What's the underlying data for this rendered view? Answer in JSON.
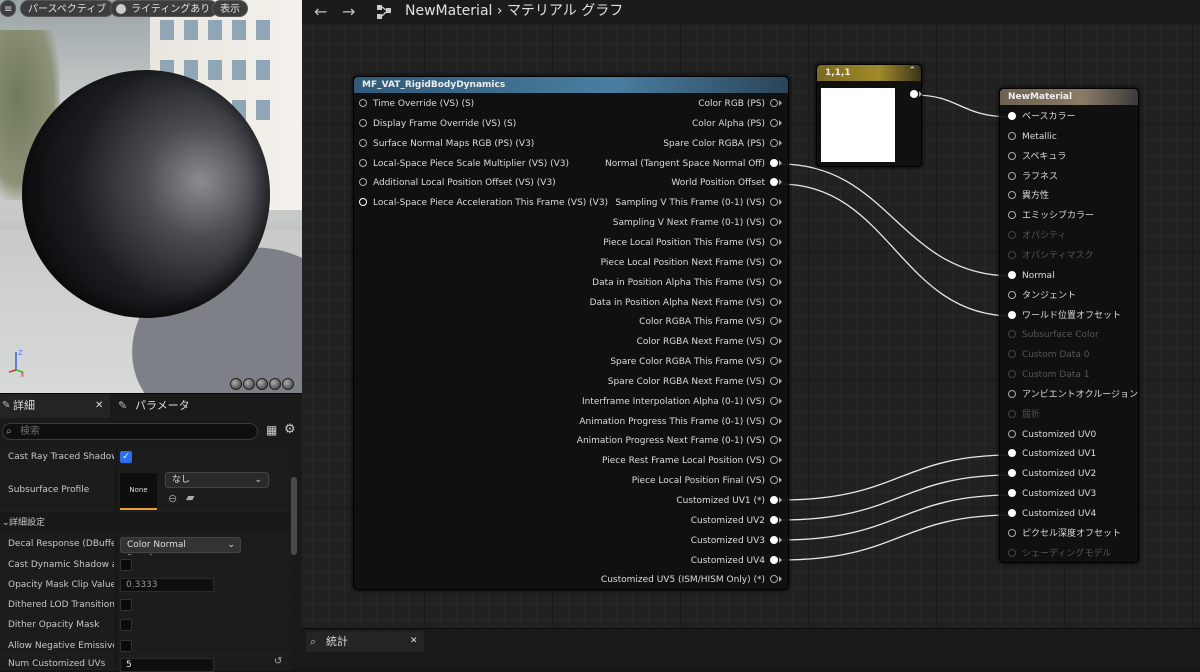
{
  "viewport": {
    "menu_icon": "hamburger-icon",
    "perspective_button": "パースペクティブ",
    "lighting_button": "ライティングあり",
    "show_button": "表示",
    "axis_z": "Z",
    "axis_x": "X"
  },
  "details": {
    "tab_label": "詳細",
    "params_tab_label": "パラメータ",
    "search_placeholder": "検索",
    "rows": {
      "cast_ray_traced_shadows": "Cast Ray Traced Shadows",
      "subsurface_profile": "Subsurface Profile",
      "subsurface_thumb": "None",
      "subsurface_value": "なし",
      "section_advanced": "詳細設定",
      "decal_response": "Decal Response (DBuffer)",
      "decal_response_value": "Color Normal Roughness",
      "cast_dynamic_shadow": "Cast Dynamic Shadow a...",
      "opacity_mask_clip": "Opacity Mask Clip Value",
      "opacity_mask_clip_value": "0.3333",
      "dithered_lod": "Dithered LOD Transition",
      "dither_opacity_mask": "Dither Opacity Mask",
      "allow_negative_emissive": "Allow Negative Emissive...",
      "num_customized_uvs": "Num Customized UVs",
      "num_customized_uvs_value": "5"
    }
  },
  "toolbar": {
    "back": "←",
    "forward": "→",
    "material_name": "NewMaterial",
    "crumb_sep": "›",
    "graph_label": "マテリアル グラフ"
  },
  "node_mf": {
    "title": "MF_VAT_RigidBodyDynamics",
    "inputs": [
      "Time Override (VS) (S)",
      "Display Frame Override (VS) (S)",
      "Surface Normal Maps RGB (PS) (V3)",
      "Local-Space Piece Scale Multiplier (VS) (V3)",
      "Additional Local Position Offset (VS) (V3)",
      "Local-Space Piece Acceleration This Frame (VS) (V3)"
    ],
    "outputs": [
      "Color RGB (PS)",
      "Color Alpha (PS)",
      "Spare Color RGBA (PS)",
      "Normal (Tangent Space Normal Off)",
      "World Position Offset",
      "Sampling V This Frame (0-1) (VS)",
      "Sampling V Next Frame (0-1) (VS)",
      "Piece Local Position This Frame (VS)",
      "Piece Local Position Next Frame (VS)",
      "Data in Position Alpha This Frame (VS)",
      "Data in Position Alpha Next Frame (VS)",
      "Color RGBA This Frame (VS)",
      "Color RGBA Next Frame (VS)",
      "Spare Color RGBA This Frame (VS)",
      "Spare Color RGBA Next Frame (VS)",
      "Interframe Interpolation Alpha (0-1) (VS)",
      "Animation Progress This Frame (0-1) (VS)",
      "Animation Progress Next Frame (0-1) (VS)",
      "Piece Rest Frame Local Position (VS)",
      "Piece Local Position Final (VS)",
      "Customized UV1 (*)",
      "Customized UV2",
      "Customized UV3",
      "Customized UV4",
      "Customized UV5 (ISM/HISM Only) (*)"
    ]
  },
  "node_const": {
    "title": "1,1,1",
    "color": "#ffffff"
  },
  "node_material": {
    "title": "NewMaterial",
    "inputs": [
      "ベースカラー",
      "Metallic",
      "スペキュラ",
      "ラフネス",
      "異方性",
      "エミッシブカラー",
      "オパシティ",
      "オパシティマスク",
      "Normal",
      "タンジェント",
      "ワールド位置オフセット",
      "Subsurface Color",
      "Custom Data 0",
      "Custom Data 1",
      "アンビエントオクルージョン",
      "屈折",
      "Customized UV0",
      "Customized UV1",
      "Customized UV2",
      "Customized UV3",
      "Customized UV4",
      "ピクセル深度オフセット",
      "シェーディングモデル"
    ]
  },
  "stats": {
    "tab_label": "統計"
  },
  "colors": {
    "mf_header": "#2f5a78",
    "const_header": "#7a6a1e",
    "material_header": "#6e6253",
    "checkbox_on": "#2a6ff0"
  }
}
